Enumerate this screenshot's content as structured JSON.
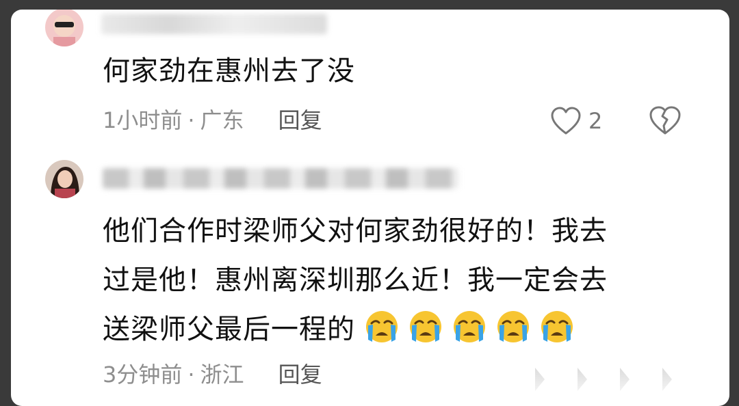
{
  "comments": [
    {
      "text": "何家劲在惠州去了没",
      "time": "1小时前",
      "separator": "·",
      "location": "广东",
      "reply_label": "回复",
      "like_count": "2",
      "icons": {
        "like": "heart-outline-icon",
        "dislike": "broken-heart-icon"
      }
    },
    {
      "lines": [
        "他们合作时梁师父对何家劲很好的！我去",
        "过是他！惠州离深圳那么近！我一定会去",
        "送梁师父最后一程的"
      ],
      "emoji_name": "loudly-crying-face-icon",
      "emoji_count": 5,
      "time": "3分钟前",
      "separator": "·",
      "location": "浙江",
      "reply_label": "回复"
    }
  ],
  "colors": {
    "primary_text": "#111111",
    "meta_text": "#8e8e8e",
    "emoji_face": "#f7c531",
    "emoji_tears": "#3aa3e6"
  }
}
